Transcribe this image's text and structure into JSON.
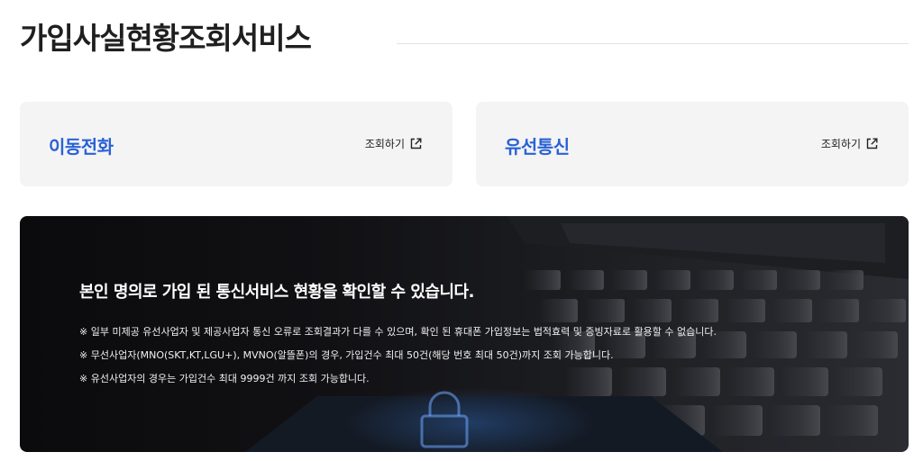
{
  "header": {
    "title": "가입사실현황조회서비스"
  },
  "cards": [
    {
      "title": "이동전화",
      "link_label": "조회하기",
      "icon": "external-link-icon"
    },
    {
      "title": "유선통신",
      "link_label": "조회하기",
      "icon": "external-link-icon"
    }
  ],
  "banner": {
    "headline": "본인 명의로 가입 된 통신서비스 현황을 확인할 수 있습니다.",
    "notes": [
      "※ 일부 미제공 유선사업자 및 제공사업자 통신 오류로 조회결과가 다를 수 있으며, 확인 된 휴대폰 가입정보는 법적효력 및 증빙자료로 활용할 수 없습니다.",
      "※ 무선사업자(MNO(SKT,KT,LGU+), MVNO(알뜰폰)의 경우, 가입건수 최대 50건(해당 번호 최대 50건)까지 조회 가능합니다.",
      "※ 유선사업자의 경우는 가입건수 최대 9999건 까지 조회 가능합니다."
    ],
    "image": "laptop-keyboard-with-lock-photo"
  },
  "colors": {
    "accent": "#2a62d6",
    "card_bg": "#f4f4f5",
    "banner_bg": "#111114"
  }
}
